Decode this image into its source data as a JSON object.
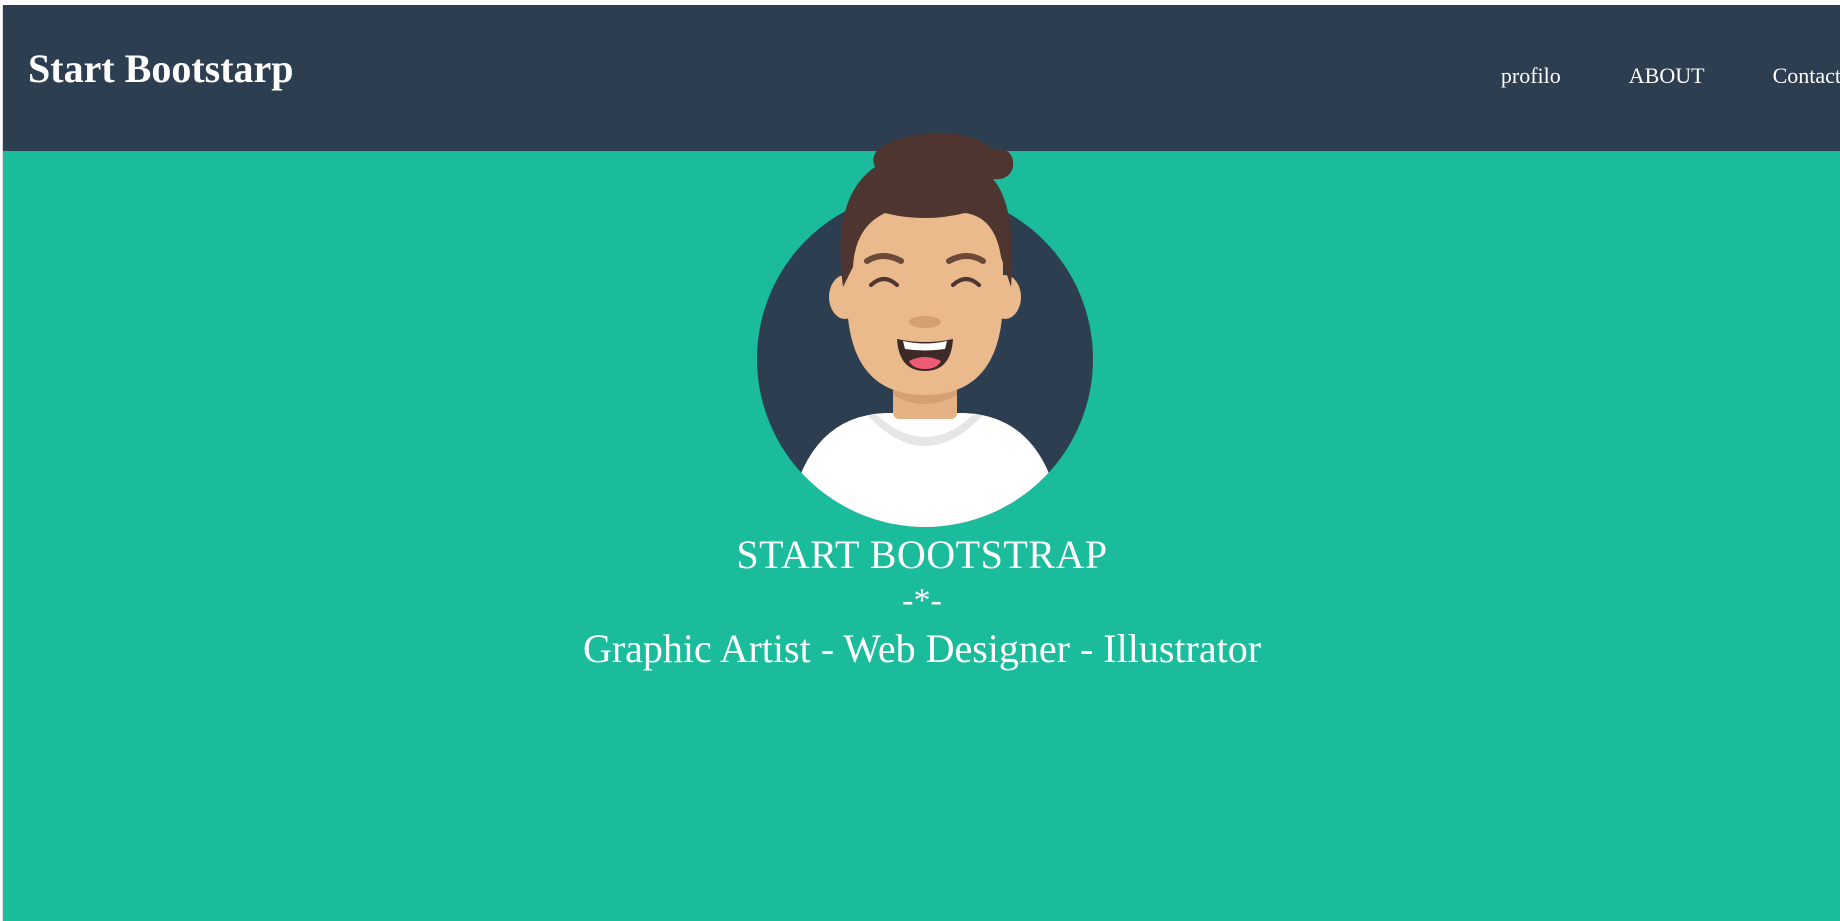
{
  "header": {
    "brand": "Start Bootstarp",
    "nav": [
      {
        "label": "profilo"
      },
      {
        "label": "ABOUT"
      },
      {
        "label": "Contact"
      }
    ]
  },
  "hero": {
    "title": "START BOOTSTRAP",
    "divider": "-*-",
    "subtitle": "Graphic Artist - Web Designer - Illustrator"
  },
  "colors": {
    "header_bg": "#2c3e50",
    "hero_bg": "#1abc9c",
    "text": "#ffffff"
  }
}
